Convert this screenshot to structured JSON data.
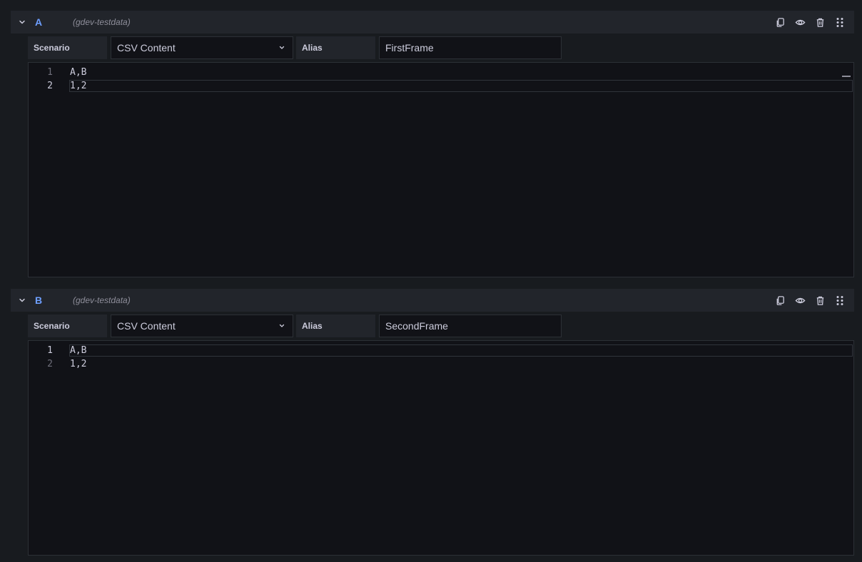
{
  "queries": [
    {
      "ref_id": "A",
      "datasource": "(gdev-testdata)",
      "scenario_label": "Scenario",
      "scenario_value": "CSV Content",
      "alias_label": "Alias",
      "alias_value": "FirstFrame",
      "lines": [
        {
          "num": "1",
          "text": "A,B"
        },
        {
          "num": "2",
          "text": "1,2"
        }
      ]
    },
    {
      "ref_id": "B",
      "datasource": "(gdev-testdata)",
      "scenario_label": "Scenario",
      "scenario_value": "CSV Content",
      "alias_label": "Alias",
      "alias_value": "SecondFrame",
      "lines": [
        {
          "num": "1",
          "text": "A,B"
        },
        {
          "num": "2",
          "text": "1,2"
        }
      ]
    }
  ],
  "icons": {
    "collapse": "chevron-down-icon",
    "duplicate": "copy-icon",
    "toggle": "eye-icon",
    "remove": "trash-icon",
    "drag": "drag-handle-icon",
    "select": "chevron-down-icon"
  },
  "colors": {
    "background": "#181b1f",
    "header": "#22252b",
    "input": "#111217",
    "border": "#2c3036",
    "ref_id": "#6e9fff",
    "text": "#ccccdc",
    "muted": "#8e8e9a"
  }
}
